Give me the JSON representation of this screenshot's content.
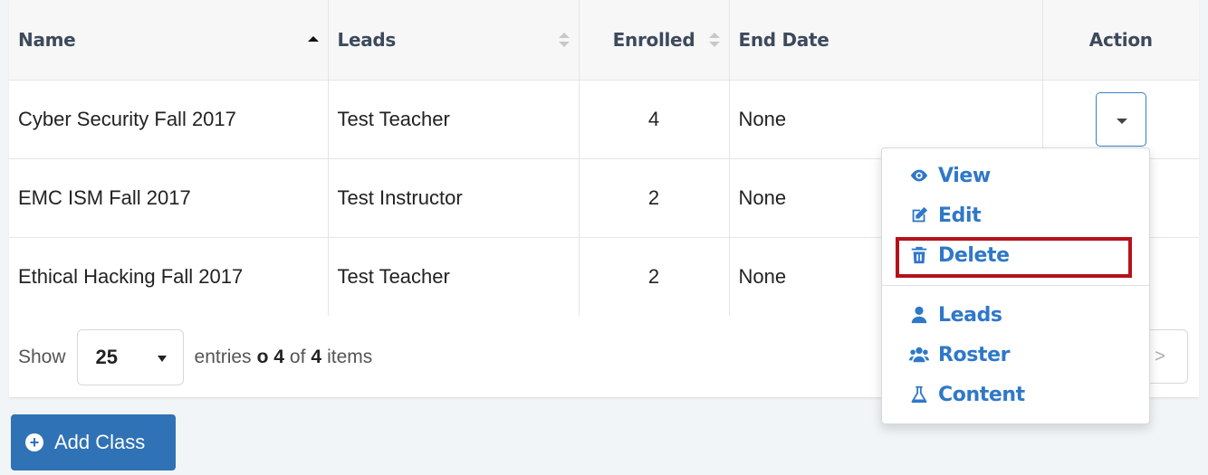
{
  "table": {
    "headers": {
      "name": "Name",
      "leads": "Leads",
      "enrolled": "Enrolled",
      "end_date": "End Date",
      "action": "Action"
    },
    "rows": [
      {
        "name": "Cyber Security Fall 2017",
        "leads": "Test Teacher",
        "enrolled": "4",
        "end_date": "None"
      },
      {
        "name": "EMC ISM Fall 2017",
        "leads": "Test Instructor",
        "enrolled": "2",
        "end_date": "None"
      },
      {
        "name": "Ethical Hacking Fall 2017",
        "leads": "Test Teacher",
        "enrolled": "2",
        "end_date": "None"
      }
    ]
  },
  "footer": {
    "show_label": "Show",
    "page_size": "25",
    "entries_label": "entries",
    "range_text": "o 4",
    "of_label": "of",
    "total": "4",
    "items_label": "items",
    "next_label": ">"
  },
  "dropdown": {
    "items": [
      {
        "label": "View",
        "icon": "eye-icon"
      },
      {
        "label": "Edit",
        "icon": "edit-icon"
      },
      {
        "label": "Delete",
        "icon": "trash-icon"
      },
      {
        "label": "Leads",
        "icon": "user-icon"
      },
      {
        "label": "Roster",
        "icon": "users-icon"
      },
      {
        "label": "Content",
        "icon": "flask-icon"
      }
    ]
  },
  "add_button": {
    "label": "Add Class"
  },
  "colors": {
    "accent": "#2f78c8",
    "button": "#2f72b5",
    "highlight": "#b5121b"
  }
}
